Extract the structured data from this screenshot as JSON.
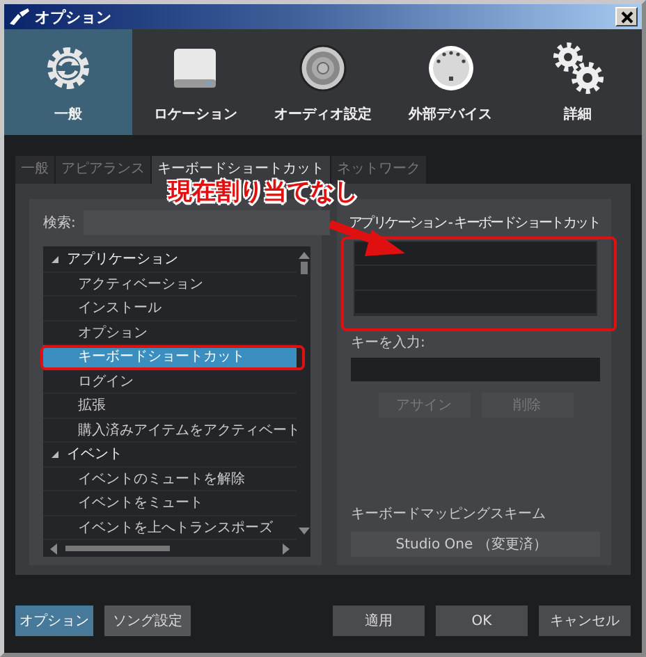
{
  "window": {
    "title": "オプション"
  },
  "categories": [
    {
      "label": "一般",
      "kind": "sync",
      "selected": true
    },
    {
      "label": "ロケーション",
      "kind": "drive",
      "selected": false
    },
    {
      "label": "オーディオ設定",
      "kind": "speaker",
      "selected": false
    },
    {
      "label": "外部デバイス",
      "kind": "connector",
      "selected": false
    },
    {
      "label": "詳細",
      "kind": "gears",
      "selected": false
    }
  ],
  "subtabs": [
    {
      "label": "一般",
      "selected": false
    },
    {
      "label": "アピアランス",
      "selected": false
    },
    {
      "label": "キーボードショートカット",
      "selected": true
    },
    {
      "label": "ネットワーク",
      "selected": false
    }
  ],
  "search": {
    "label": "検索:"
  },
  "tree": [
    {
      "label": "アプリケーション",
      "expanded": true,
      "children": [
        {
          "label": "アクティベーション",
          "selected": false
        },
        {
          "label": "インストール",
          "selected": false
        },
        {
          "label": "オプション",
          "selected": false
        },
        {
          "label": "キーボードショートカット",
          "selected": true
        },
        {
          "label": "ログイン",
          "selected": false
        },
        {
          "label": "拡張",
          "selected": false
        },
        {
          "label": "購入済みアイテムをアクティベート",
          "selected": false
        }
      ]
    },
    {
      "label": "イベント",
      "expanded": true,
      "children": [
        {
          "label": "イベントのミュートを解除",
          "selected": false
        },
        {
          "label": "イベントをミュート",
          "selected": false
        },
        {
          "label": "イベントを上へトランスポーズ",
          "selected": false
        }
      ]
    }
  ],
  "shortcut_list": {
    "title": "アプリケーション - キーボードショートカット"
  },
  "key_input": {
    "label": "キーを入力:"
  },
  "key_buttons": [
    {
      "label": "アサイン",
      "disabled": true
    },
    {
      "label": "削除",
      "disabled": true
    }
  ],
  "mapping": {
    "label": "キーボードマッピングスキーム",
    "value": "Studio One （変更済）"
  },
  "footer_tabs": [
    {
      "label": "オプション",
      "selected": true
    },
    {
      "label": "ソング設定",
      "selected": false
    }
  ],
  "footer_buttons": [
    "適用",
    "OK",
    "キャンセル"
  ],
  "annotation": {
    "callout": "現在割り当てなし"
  }
}
